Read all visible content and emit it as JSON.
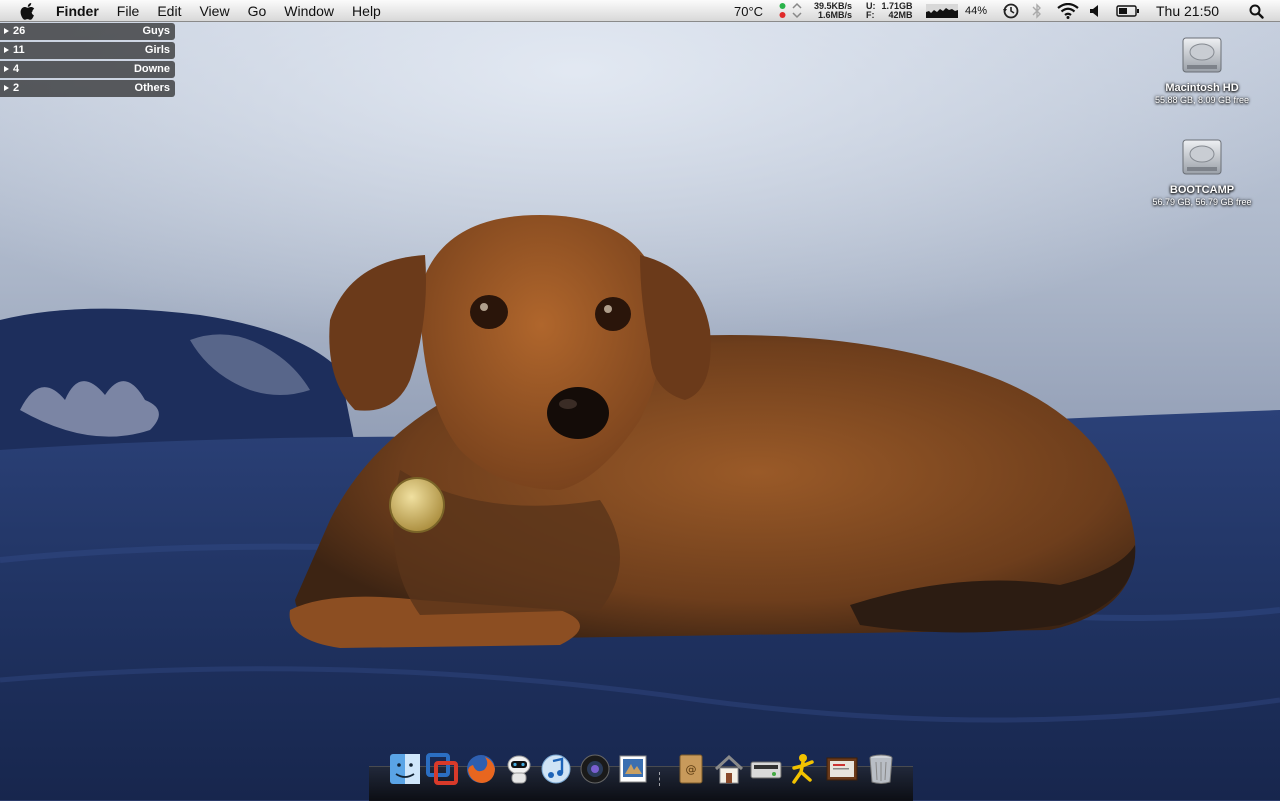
{
  "menubar": {
    "apple_icon": "apple-logo-icon",
    "app_name": "Finder",
    "items": [
      "File",
      "Edit",
      "View",
      "Go",
      "Window",
      "Help"
    ],
    "temperature": "70°C",
    "net_up": "39.5KB/s",
    "net_down": "1.6MB/s",
    "mem_used_label": "U:",
    "mem_used": "1.71GB",
    "mem_free_label": "F:",
    "mem_free": "42MB",
    "battery_percent": "44%",
    "clock": "Thu 21:50"
  },
  "user_widget": {
    "rows": [
      {
        "count": "26",
        "label": "Guys"
      },
      {
        "count": "11",
        "label": "Girls"
      },
      {
        "count": "4",
        "label": "Downe"
      },
      {
        "count": "2",
        "label": "Others"
      }
    ]
  },
  "desktop": {
    "drives": [
      {
        "name": "Macintosh HD",
        "info": "55.88 GB, 8.09 GB free",
        "icon": "hard-drive-icon"
      },
      {
        "name": "BOOTCAMP",
        "info": "56.79 GB, 56.79 GB free",
        "icon": "hard-drive-icon"
      }
    ]
  },
  "dock": {
    "apps": [
      "finder-icon",
      "vmware-fusion-icon",
      "firefox-icon",
      "robot-app-icon",
      "itunes-icon",
      "photo-booth-icon",
      "preview-icon",
      "address-book-icon",
      "home-folder-icon",
      "scanner-icon",
      "aim-icon",
      "presentation-icon",
      "trash-icon"
    ]
  },
  "colors": {
    "wall": "#b9c4d6",
    "bedding": "#1f3466",
    "dog_coat": "#8a4f22",
    "menubar_bg": "#e8e8e8"
  }
}
